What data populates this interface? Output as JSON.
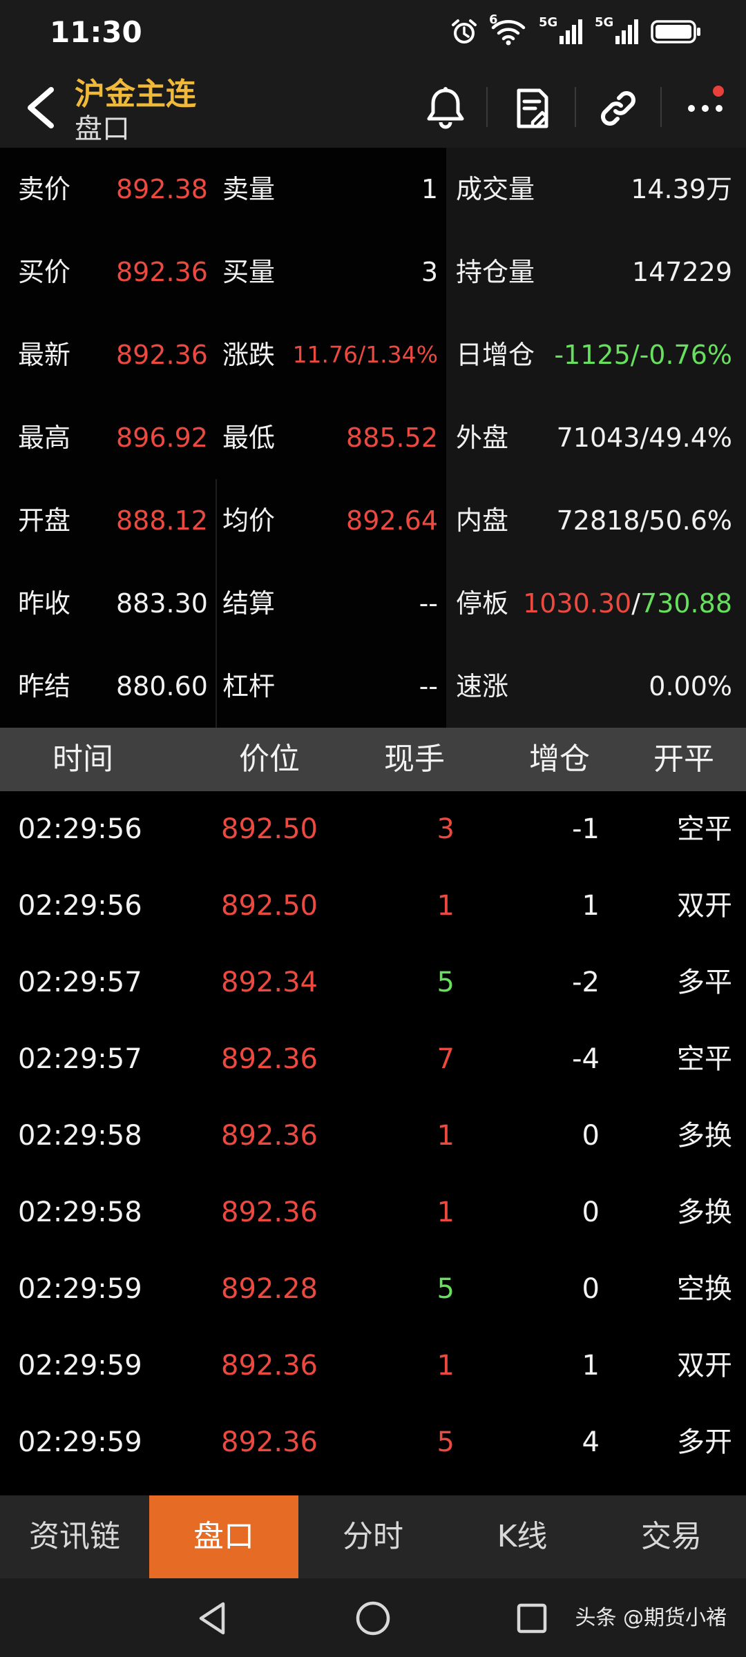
{
  "status": {
    "time": "11:30",
    "net1": "5G",
    "net2": "5G",
    "wifi_badge": "6"
  },
  "header": {
    "title": "沪金主连",
    "subtitle": "盘口"
  },
  "quote": {
    "sell_price_label": "卖价",
    "sell_price": "892.38",
    "sell_vol_label": "卖量",
    "sell_vol": "1",
    "volume_label": "成交量",
    "volume": "14.39万",
    "buy_price_label": "买价",
    "buy_price": "892.36",
    "buy_vol_label": "买量",
    "buy_vol": "3",
    "oi_label": "持仓量",
    "oi": "147229",
    "last_label": "最新",
    "last": "892.36",
    "change_label": "涨跌",
    "change": "11.76/1.34%",
    "oi_chg_label": "日增仓",
    "oi_chg": "-1125/-0.76%",
    "high_label": "最高",
    "high": "896.92",
    "low_label": "最低",
    "low": "885.52",
    "outer_label": "外盘",
    "outer": "71043/49.4%",
    "open_label": "开盘",
    "open": "888.12",
    "avg_label": "均价",
    "avg": "892.64",
    "inner_label": "内盘",
    "inner": "72818/50.6%",
    "prev_close_label": "昨收",
    "prev_close": "883.30",
    "settle_label": "结算",
    "settle": "--",
    "limit_label": "停板",
    "limit_up": "1030.30",
    "limit_sep": "/",
    "limit_down": "730.88",
    "prev_settle_label": "昨结",
    "prev_settle": "880.60",
    "leverage_label": "杠杆",
    "leverage": "--",
    "speed_label": "速涨",
    "speed": "0.00%"
  },
  "ticks": {
    "headers": {
      "time": "时间",
      "price": "价位",
      "qty": "现手",
      "oi": "增仓",
      "type": "开平"
    },
    "rows": [
      {
        "time": "02:29:56",
        "price": "892.50",
        "qty": "3",
        "qty_color": "#ec4a40",
        "oi": "-1",
        "type": "空平"
      },
      {
        "time": "02:29:56",
        "price": "892.50",
        "qty": "1",
        "qty_color": "#ec4a40",
        "oi": "1",
        "type": "双开"
      },
      {
        "time": "02:29:57",
        "price": "892.34",
        "qty": "5",
        "qty_color": "#67e05d",
        "oi": "-2",
        "type": "多平"
      },
      {
        "time": "02:29:57",
        "price": "892.36",
        "qty": "7",
        "qty_color": "#ec4a40",
        "oi": "-4",
        "type": "空平"
      },
      {
        "time": "02:29:58",
        "price": "892.36",
        "qty": "1",
        "qty_color": "#ec4a40",
        "oi": "0",
        "type": "多换"
      },
      {
        "time": "02:29:58",
        "price": "892.36",
        "qty": "1",
        "qty_color": "#ec4a40",
        "oi": "0",
        "type": "多换"
      },
      {
        "time": "02:29:59",
        "price": "892.28",
        "qty": "5",
        "qty_color": "#67e05d",
        "oi": "0",
        "type": "空换"
      },
      {
        "time": "02:29:59",
        "price": "892.36",
        "qty": "1",
        "qty_color": "#ec4a40",
        "oi": "1",
        "type": "双开"
      },
      {
        "time": "02:29:59",
        "price": "892.36",
        "qty": "5",
        "qty_color": "#ec4a40",
        "oi": "4",
        "type": "多开"
      }
    ]
  },
  "tabs": [
    "资讯链",
    "盘口",
    "分时",
    "K线",
    "交易"
  ],
  "watermark": "头条 @期货小褚"
}
